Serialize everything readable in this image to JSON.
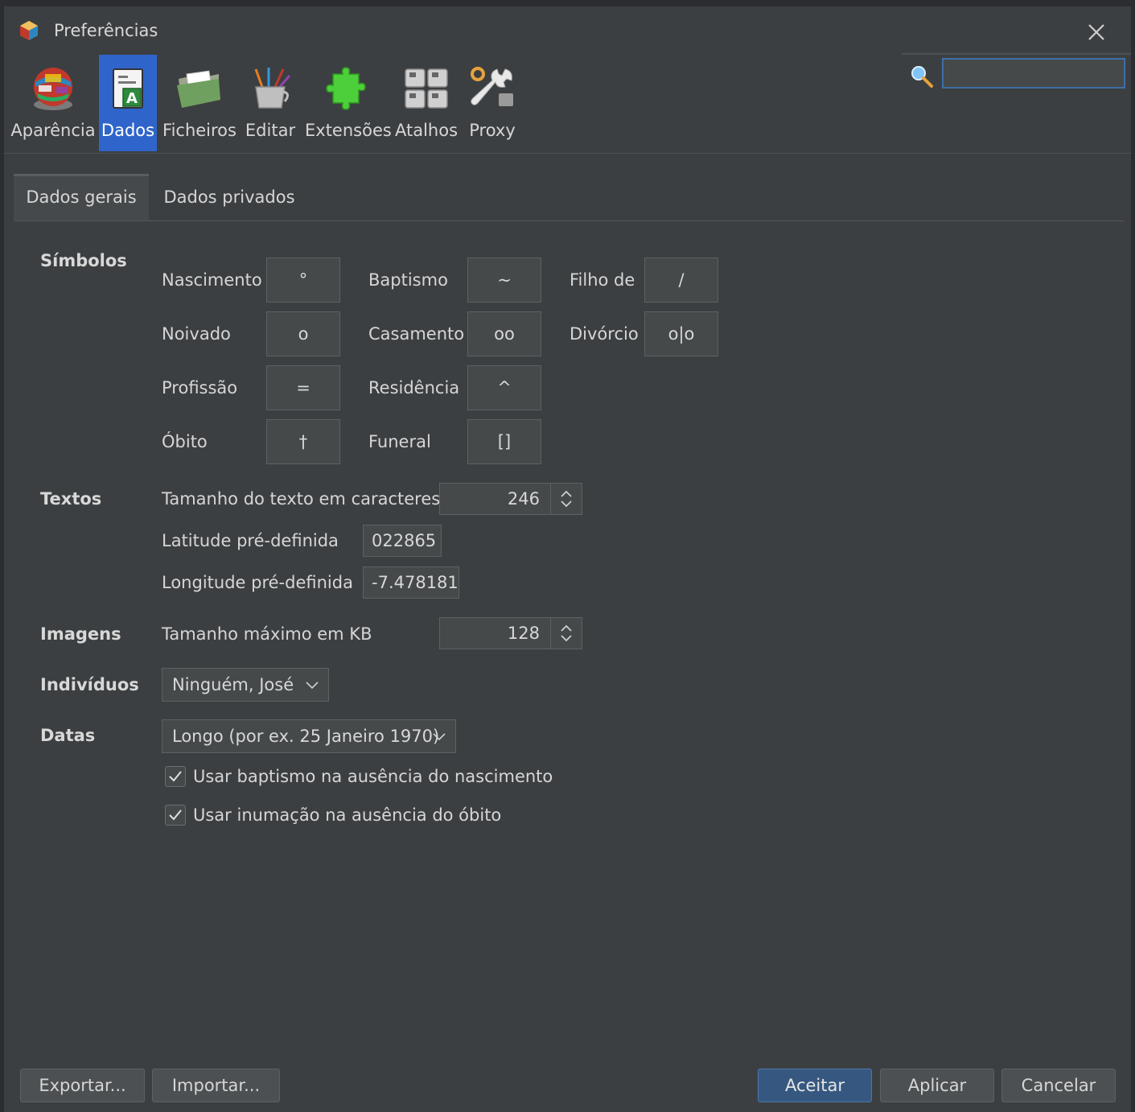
{
  "window": {
    "title": "Preferências"
  },
  "toolbar": {
    "items": [
      {
        "label": "Aparência",
        "icon": "globe-icon"
      },
      {
        "label": "Dados",
        "icon": "document-icon"
      },
      {
        "label": "Ficheiros",
        "icon": "folder-icon"
      },
      {
        "label": "Editar",
        "icon": "tools-cup-icon"
      },
      {
        "label": "Extensões",
        "icon": "puzzle-icon"
      },
      {
        "label": "Atalhos",
        "icon": "keyboard-icon"
      },
      {
        "label": "Proxy",
        "icon": "wrench-icon"
      }
    ],
    "selected": "Dados"
  },
  "search": {
    "value": "",
    "placeholder": ""
  },
  "tabs": [
    {
      "label": "Dados gerais",
      "active": true
    },
    {
      "label": "Dados privados",
      "active": false
    }
  ],
  "symbols": {
    "section": "Símbolos",
    "birth": {
      "label": "Nascimento",
      "value": "°"
    },
    "baptism": {
      "label": "Baptismo",
      "value": "~"
    },
    "child_of": {
      "label": "Filho de",
      "value": "/"
    },
    "engagement": {
      "label": "Noivado",
      "value": "o"
    },
    "marriage": {
      "label": "Casamento",
      "value": "oo"
    },
    "divorce": {
      "label": "Divórcio",
      "value": "o|o"
    },
    "occupation": {
      "label": "Profissão",
      "value": "="
    },
    "residence": {
      "label": "Residência",
      "value": "^"
    },
    "death": {
      "label": "Óbito",
      "value": "†"
    },
    "burial": {
      "label": "Funeral",
      "value": "[]"
    }
  },
  "texts": {
    "section": "Textos",
    "text_size": {
      "label": "Tamanho do texto em caracteres",
      "value": "246"
    },
    "latitude": {
      "label": "Latitude pré-definida",
      "value": "022865"
    },
    "longitude": {
      "label": "Longitude pré-definida",
      "value": "-7.478181"
    }
  },
  "images": {
    "section": "Imagens",
    "max_size": {
      "label": "Tamanho máximo em KB",
      "value": "128"
    }
  },
  "individuals": {
    "section": "Indivíduos",
    "value": "Ninguém, José"
  },
  "dates": {
    "section": "Datas",
    "format": "Longo (por ex. 25 Janeiro 1970)",
    "use_baptism": {
      "label": "Usar baptismo na ausência do nascimento",
      "checked": true
    },
    "use_burial": {
      "label": "Usar inumação na ausência do óbito",
      "checked": true
    }
  },
  "buttons": {
    "export": "Exportar...",
    "import": "Importar...",
    "accept": "Aceitar",
    "apply": "Aplicar",
    "cancel": "Cancelar"
  },
  "colors": {
    "accent": "#2f65ca",
    "background": "#3c3f41",
    "primary_button": "#365880"
  }
}
